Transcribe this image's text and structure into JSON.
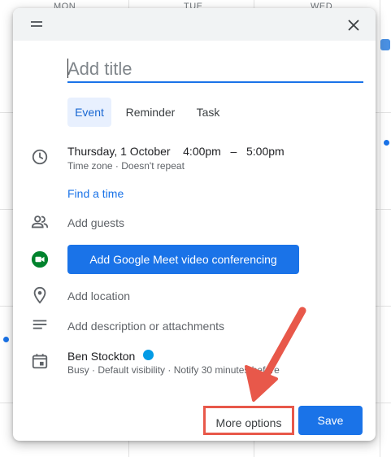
{
  "calendar": {
    "days": [
      "MON",
      "TUE",
      "WED"
    ]
  },
  "dialog": {
    "title_placeholder": "Add title",
    "tabs": [
      "Event",
      "Reminder",
      "Task"
    ],
    "datetime": {
      "date": "Thursday, 1 October",
      "start": "4:00pm",
      "separator": "–",
      "end": "5:00pm",
      "details": "Time zone · Doesn't repeat"
    },
    "find_time": "Find a time",
    "add_guests": "Add guests",
    "meet_button": "Add Google Meet video conferencing",
    "add_location": "Add location",
    "add_description": "Add description or attachments",
    "calendar_owner": {
      "name": "Ben Stockton",
      "color": "#039be5",
      "details": "Busy · Default visibility · Notify 30 minutes before"
    },
    "more_options": "More options",
    "save": "Save"
  },
  "colors": {
    "accent": "#1a73e8",
    "highlight": "#e8584a"
  },
  "icons": [
    "drag-handle-icon",
    "close-icon",
    "clock-icon",
    "people-icon",
    "google-meet-icon",
    "location-pin-icon",
    "description-icon",
    "calendar-icon"
  ]
}
